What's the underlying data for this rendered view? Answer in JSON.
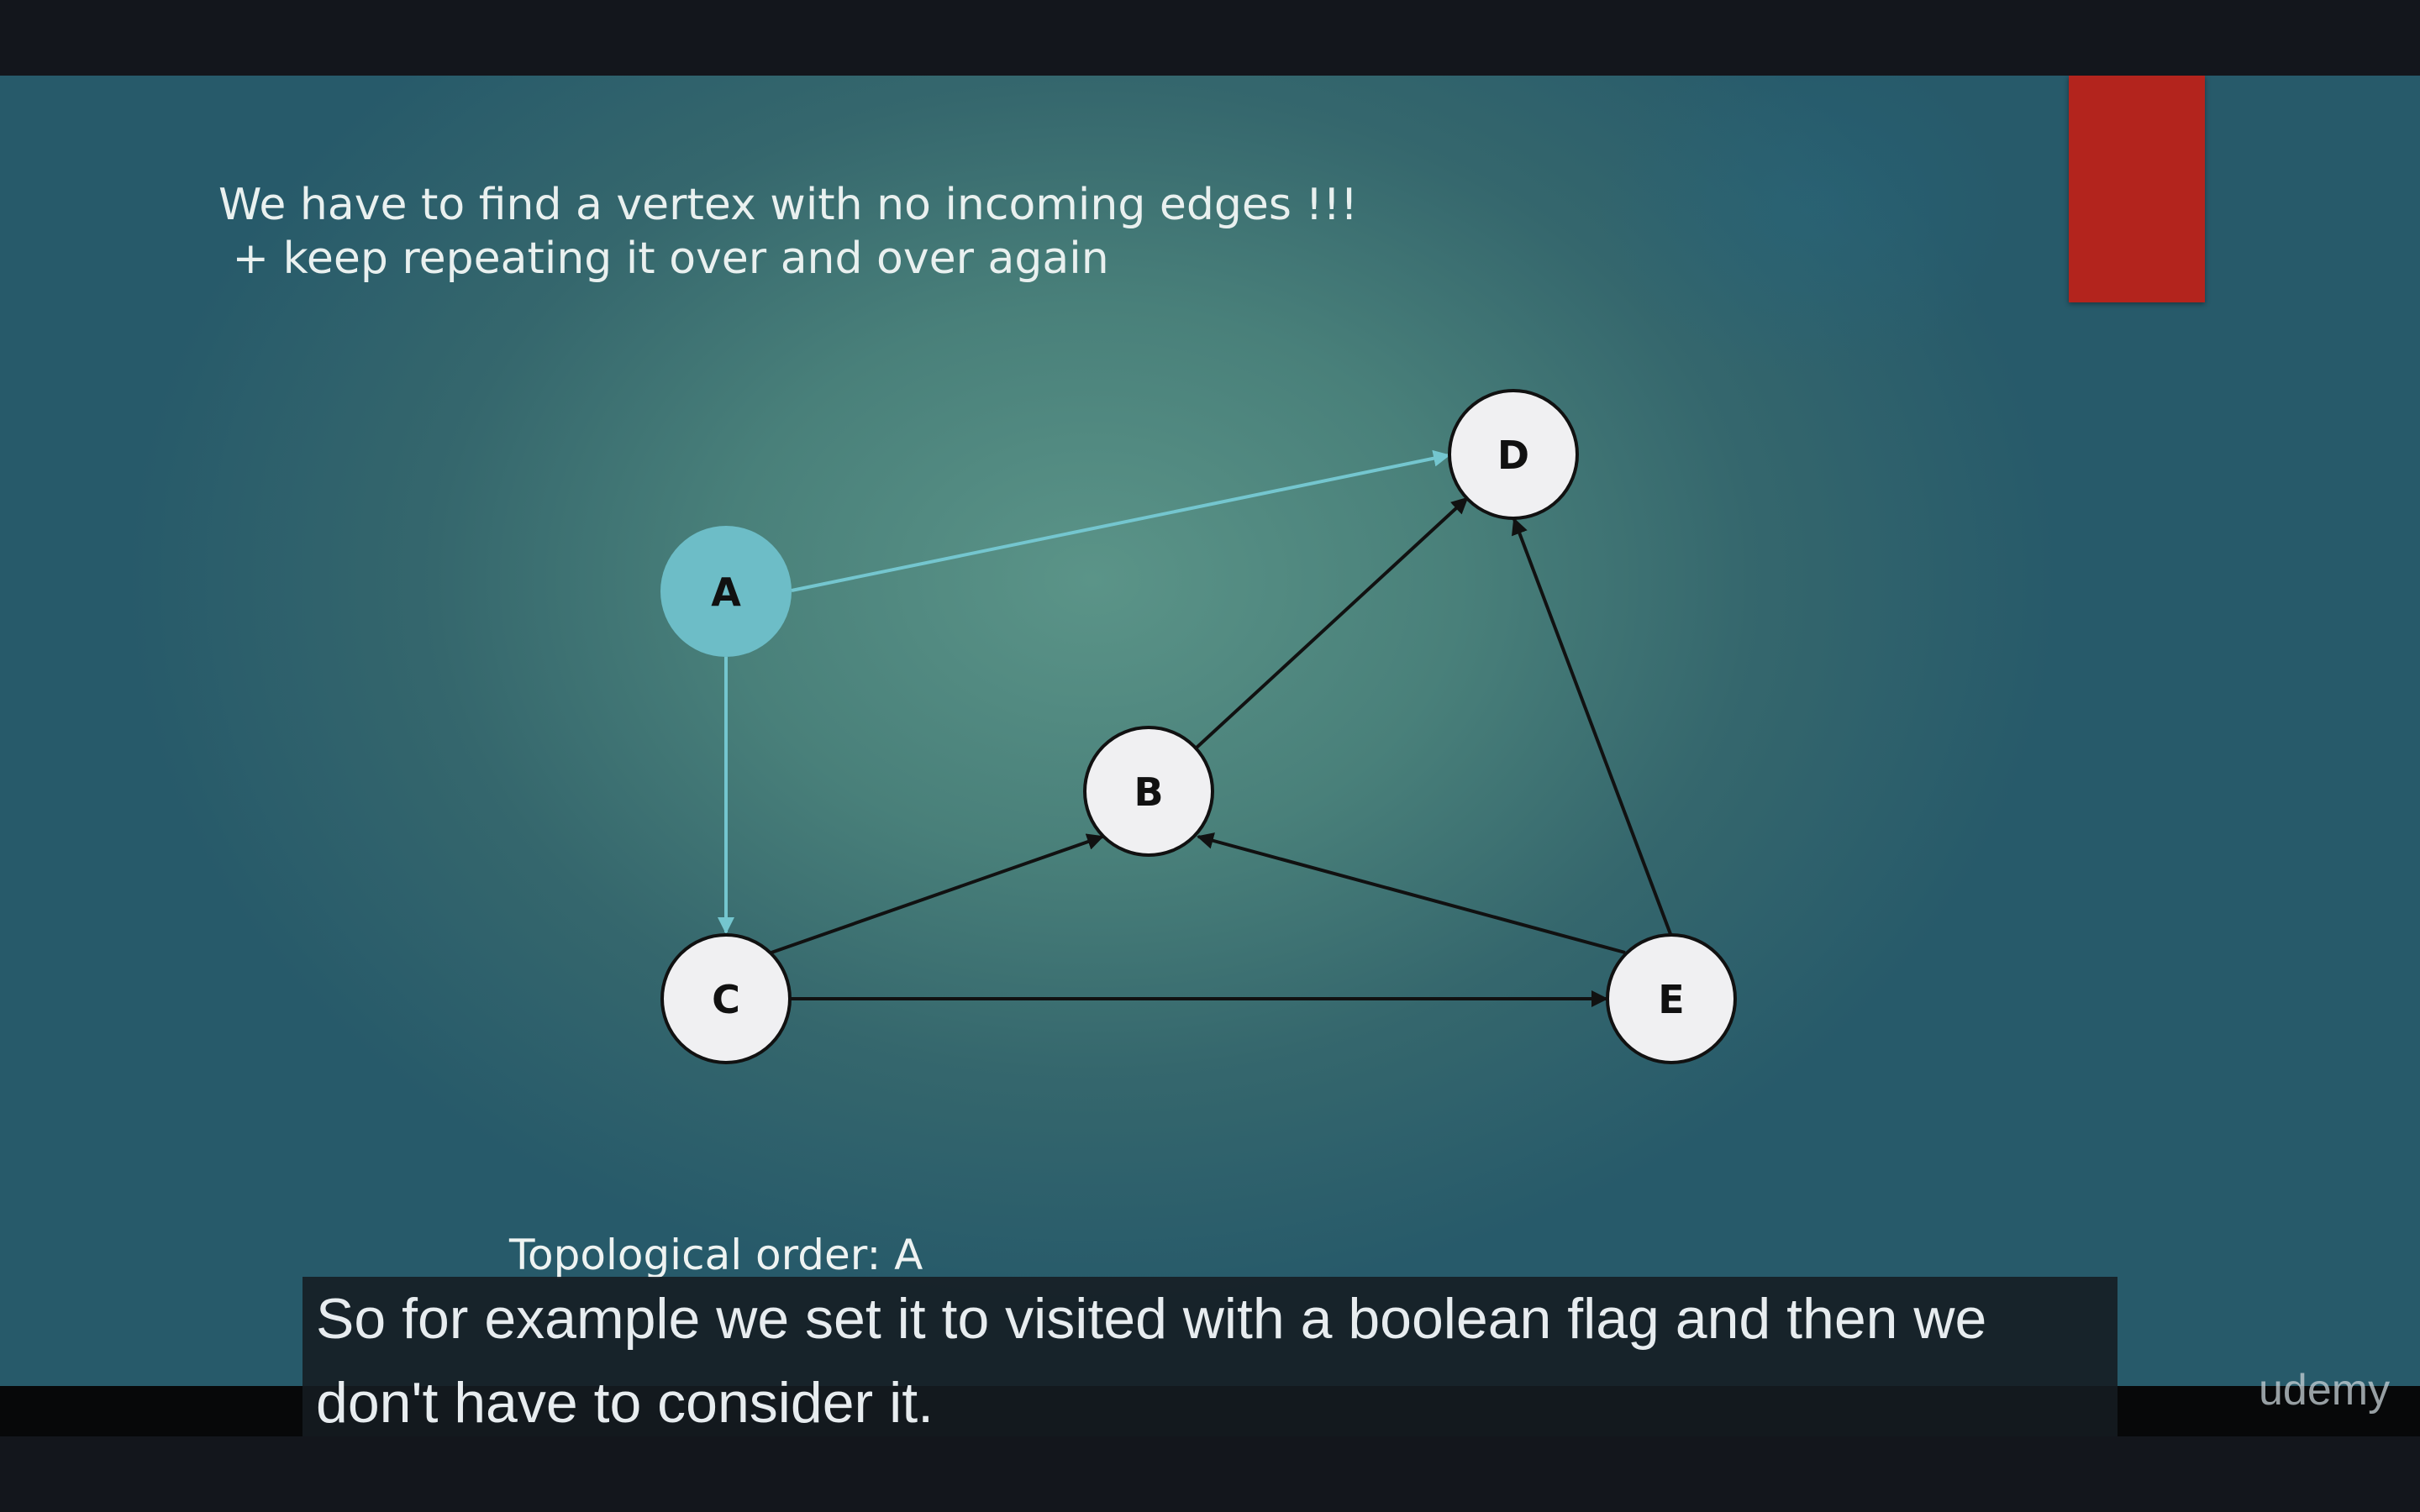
{
  "slide": {
    "headline_line1": "We have to find a vertex with no incoming edges !!!",
    "headline_line2": " + keep repeating it over and over again",
    "order_label": "Topological order: A"
  },
  "graph": {
    "nodes": [
      "A",
      "B",
      "C",
      "D",
      "E"
    ],
    "visited": [
      "A"
    ],
    "edges": [
      [
        "A",
        "D"
      ],
      [
        "A",
        "C"
      ],
      [
        "B",
        "D"
      ],
      [
        "C",
        "B"
      ],
      [
        "C",
        "E"
      ],
      [
        "E",
        "B"
      ],
      [
        "E",
        "D"
      ]
    ],
    "colors": {
      "visited_fill": "#6dbdc7",
      "visited_edge": "#74c6cf",
      "default_fill": "#f0f0f2",
      "default_edge": "#111111"
    }
  },
  "subtitle": {
    "line1": "So for example we set it to visited with a boolean flag and then we",
    "line2": "don't have to consider it."
  },
  "watermark": "udemy"
}
